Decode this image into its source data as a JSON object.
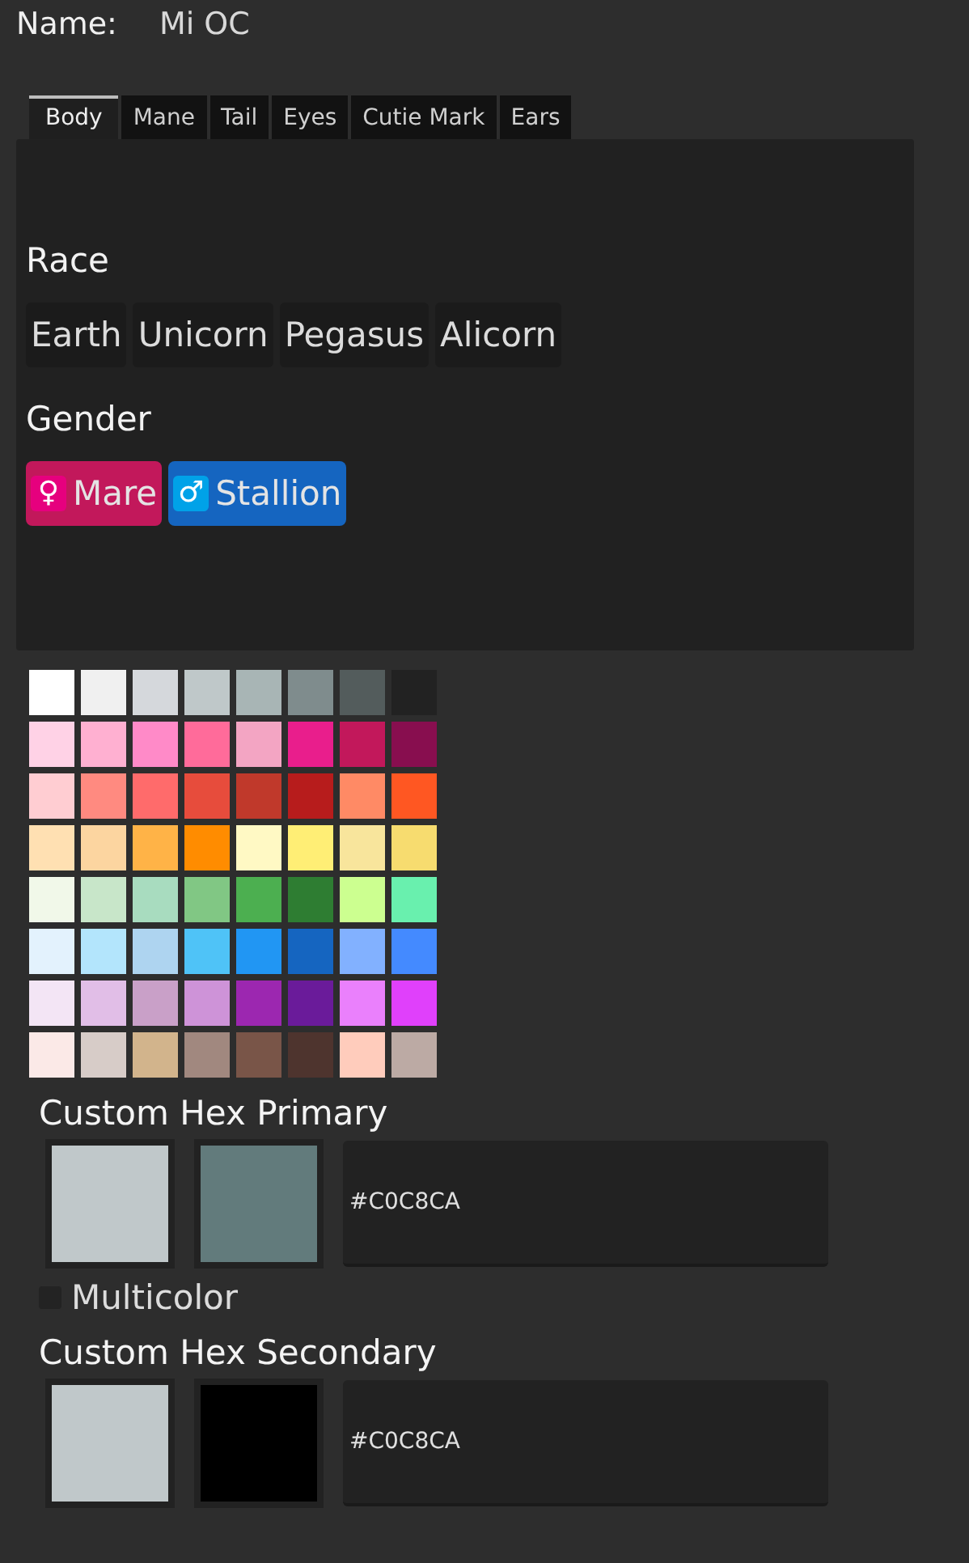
{
  "name": {
    "label": "Name:",
    "value": "Mi OC"
  },
  "tabs": [
    {
      "label": "Body",
      "selected": true
    },
    {
      "label": "Mane",
      "selected": false
    },
    {
      "label": "Tail",
      "selected": false
    },
    {
      "label": "Eyes",
      "selected": false
    },
    {
      "label": "Cutie Mark",
      "selected": false
    },
    {
      "label": "Ears",
      "selected": false
    }
  ],
  "race": {
    "heading": "Race",
    "options": [
      "Earth",
      "Unicorn",
      "Pegasus",
      "Alicorn"
    ]
  },
  "gender": {
    "heading": "Gender",
    "options": [
      {
        "icon": "♀",
        "label": "Mare",
        "color": "#c2185b"
      },
      {
        "icon": "♂",
        "label": "Stallion",
        "color": "#1565c0"
      }
    ]
  },
  "palette": [
    {
      "color": "#ffffff"
    },
    {
      "color": "#f0f0f0"
    },
    {
      "color": "#d5d8dc"
    },
    {
      "color": "#bfc8c9"
    },
    {
      "color": "#a8b5b5"
    },
    {
      "color": "#7f8c8d"
    },
    {
      "color": "#535c5c"
    },
    {
      "color": "#222222"
    },
    {
      "color": "#ffd2e6"
    },
    {
      "color": "#ffb0d1"
    },
    {
      "color": "#ff8ac8"
    },
    {
      "color": "#ff6b9a"
    },
    {
      "color": "#f3a5c3"
    },
    {
      "color": "#e91e8c"
    },
    {
      "color": "#c2185b"
    },
    {
      "color": "#880e4f"
    },
    {
      "color": "#ffcdd2"
    },
    {
      "color": "#ff8a80"
    },
    {
      "color": "#ff6b6b"
    },
    {
      "color": "#e74c3c"
    },
    {
      "color": "#c0392b"
    },
    {
      "color": "#b71c1c"
    },
    {
      "color": "#ff8a65"
    },
    {
      "color": "#ff5722"
    },
    {
      "color": "#ffe0b2"
    },
    {
      "color": "#fcd5a0"
    },
    {
      "color": "#ffb347"
    },
    {
      "color": "#ff8c00"
    },
    {
      "color": "#fff9c4"
    },
    {
      "color": "#ffee75"
    },
    {
      "color": "#f8e59c"
    },
    {
      "color": "#f7dc6f"
    },
    {
      "color": "#f1f8e9"
    },
    {
      "color": "#c8e6c9"
    },
    {
      "color": "#a8dcbf"
    },
    {
      "color": "#81c784"
    },
    {
      "color": "#4caf50"
    },
    {
      "color": "#2e7d32"
    },
    {
      "color": "#ccff90"
    },
    {
      "color": "#69f0ae"
    },
    {
      "color": "#e3f2fd"
    },
    {
      "color": "#b3e5fc"
    },
    {
      "color": "#aed4f0"
    },
    {
      "color": "#4fc3f7"
    },
    {
      "color": "#2196f3"
    },
    {
      "color": "#1565c0"
    },
    {
      "color": "#82b1ff"
    },
    {
      "color": "#448aff"
    },
    {
      "color": "#f3e5f5"
    },
    {
      "color": "#e1bee7"
    },
    {
      "color": "#c9a0c8"
    },
    {
      "color": "#ce93d8"
    },
    {
      "color": "#9c27b0"
    },
    {
      "color": "#6a1b9a"
    },
    {
      "color": "#ea80fc"
    },
    {
      "color": "#e040fb"
    },
    {
      "color": "#fbe9e7"
    },
    {
      "color": "#d7ccc8"
    },
    {
      "color": "#d2b48c"
    },
    {
      "color": "#a1887f"
    },
    {
      "color": "#795548"
    },
    {
      "color": "#4e342e"
    },
    {
      "color": "#ffccbc"
    },
    {
      "color": "#bcaaa4"
    }
  ],
  "primary": {
    "heading": "Custom Hex Primary",
    "swatches": [
      {
        "color": "#c0c8ca"
      },
      {
        "color": "#627b7c"
      }
    ],
    "value": "#C0C8CA"
  },
  "multicolor": {
    "label": "Multicolor",
    "checked": false
  },
  "secondary": {
    "heading": "Custom Hex Secondary",
    "swatches": [
      {
        "color": "#c0c8ca"
      },
      {
        "color": "#000000"
      }
    ],
    "value": "#C0C8CA"
  }
}
